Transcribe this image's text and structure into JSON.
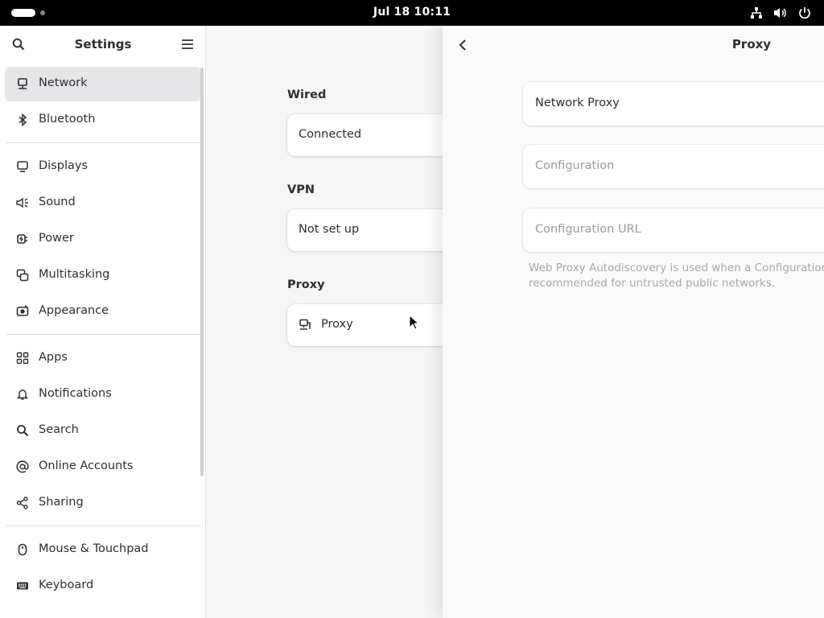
{
  "topbar": {
    "clock": "Jul 18  10:11",
    "tray_icons": [
      "network-wired-icon",
      "volume-icon",
      "power-icon"
    ]
  },
  "sidebar": {
    "title": "Settings",
    "items": [
      {
        "label": "Network",
        "icon": "network-icon",
        "selected": true
      },
      {
        "label": "Bluetooth",
        "icon": "bluetooth-icon"
      },
      {
        "label": "Displays",
        "icon": "display-icon"
      },
      {
        "label": "Sound",
        "icon": "sound-icon"
      },
      {
        "label": "Power",
        "icon": "power-plug-icon"
      },
      {
        "label": "Multitasking",
        "icon": "multitasking-icon"
      },
      {
        "label": "Appearance",
        "icon": "appearance-icon"
      },
      {
        "label": "Apps",
        "icon": "apps-icon"
      },
      {
        "label": "Notifications",
        "icon": "bell-icon"
      },
      {
        "label": "Search",
        "icon": "search-icon"
      },
      {
        "label": "Online Accounts",
        "icon": "at-sign-icon"
      },
      {
        "label": "Sharing",
        "icon": "share-icon"
      },
      {
        "label": "Mouse & Touchpad",
        "icon": "mouse-icon"
      },
      {
        "label": "Keyboard",
        "icon": "keyboard-icon"
      }
    ]
  },
  "network": {
    "wired": {
      "title": "Wired",
      "status": "Connected"
    },
    "vpn": {
      "title": "VPN",
      "status": "Not set up"
    },
    "proxy": {
      "title": "Proxy",
      "label": "Proxy"
    }
  },
  "proxy_panel": {
    "title": "Proxy",
    "network_proxy_label": "Network Proxy",
    "configuration_label": "Configuration",
    "configuration_url_label": "Configuration URL",
    "note_line1": "Web Proxy Autodiscovery is used when a Configuration U",
    "note_line2": "recommended for untrusted public networks."
  },
  "colors": {
    "topbar": "#000000",
    "sidebar_selected": "#e6e6e8",
    "main_bg": "#f6f6f6",
    "panel_bg": "#fafafa",
    "text": "#2e2e33",
    "muted_text": "#9a9a9e"
  }
}
